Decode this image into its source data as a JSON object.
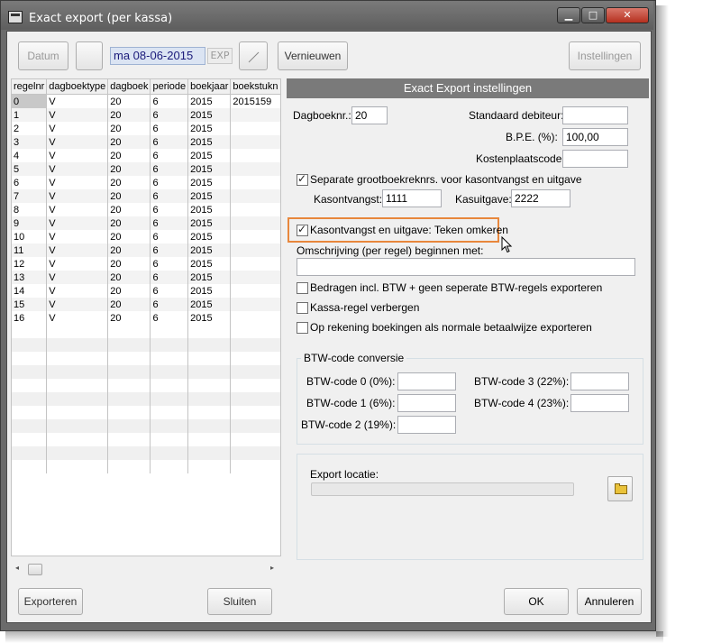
{
  "window": {
    "title": "Exact export (per kassa)",
    "minimize_glyph": "▁",
    "maximize_glyph": "□",
    "close_glyph": "✕"
  },
  "toolbar": {
    "datum_label": "Datum",
    "date_value": "ma 08-06-2015",
    "exp_label": "EXP",
    "refresh_label": "Vernieuwen",
    "settings_label": "Instellingen"
  },
  "table": {
    "columns": [
      "regelnr",
      "dagboektype",
      "dagboek",
      "periode",
      "boekjaar",
      "boekstukn"
    ],
    "rows": [
      [
        "0",
        "V",
        "20",
        "6",
        "2015",
        "2015159"
      ],
      [
        "1",
        "V",
        "20",
        "6",
        "2015",
        ""
      ],
      [
        "2",
        "V",
        "20",
        "6",
        "2015",
        ""
      ],
      [
        "3",
        "V",
        "20",
        "6",
        "2015",
        ""
      ],
      [
        "4",
        "V",
        "20",
        "6",
        "2015",
        ""
      ],
      [
        "5",
        "V",
        "20",
        "6",
        "2015",
        ""
      ],
      [
        "6",
        "V",
        "20",
        "6",
        "2015",
        ""
      ],
      [
        "7",
        "V",
        "20",
        "6",
        "2015",
        ""
      ],
      [
        "8",
        "V",
        "20",
        "6",
        "2015",
        ""
      ],
      [
        "9",
        "V",
        "20",
        "6",
        "2015",
        ""
      ],
      [
        "10",
        "V",
        "20",
        "6",
        "2015",
        ""
      ],
      [
        "11",
        "V",
        "20",
        "6",
        "2015",
        ""
      ],
      [
        "12",
        "V",
        "20",
        "6",
        "2015",
        ""
      ],
      [
        "13",
        "V",
        "20",
        "6",
        "2015",
        ""
      ],
      [
        "14",
        "V",
        "20",
        "6",
        "2015",
        ""
      ],
      [
        "15",
        "V",
        "20",
        "6",
        "2015",
        ""
      ],
      [
        "16",
        "V",
        "20",
        "6",
        "2015",
        ""
      ]
    ],
    "scroll_left": "◂",
    "scroll_right": "▸"
  },
  "settings": {
    "header": "Exact Export instellingen",
    "dagboeknr_label": "Dagboeknr.:",
    "dagboeknr_value": "20",
    "std_debiteur_label": "Standaard debiteur:",
    "std_debiteur_value": "",
    "bpe_label": "B.P.E. (%):",
    "bpe_value": "100,00",
    "kostenplaats_label": "Kostenplaatscode:",
    "kostenplaats_value": "",
    "separate_label": "Separate grootboekreknrs. voor kasontvangst en uitgave",
    "separate_checked": true,
    "kasontvangst_label": "Kasontvangst:",
    "kasontvangst_value": "1111",
    "kasuitgave_label": "Kasuitgave:",
    "kasuitgave_value": "2222",
    "omkeren_label": "Kasontvangst en uitgave: Teken omkeren",
    "omkeren_checked": true,
    "omschrijving_label": "Omschrijving (per regel) beginnen met:",
    "omschrijving_value": "",
    "incl_btw_label": "Bedragen incl. BTW + geen seperate BTW-regels exporteren",
    "incl_btw_checked": false,
    "kassa_regel_label": "Kassa-regel verbergen",
    "kassa_regel_checked": false,
    "op_rekening_label": "Op rekening boekingen als normale betaalwijze exporteren",
    "op_rekening_checked": false,
    "btw_group_title": "BTW-code conversie",
    "btw0_label": "BTW-code 0 (0%):",
    "btw1_label": "BTW-code 1 (6%):",
    "btw2_label": "BTW-code 2 (19%):",
    "btw3_label": "BTW-code 3 (22%):",
    "btw4_label": "BTW-code 4 (23%):",
    "export_locatie_label": "Export locatie:"
  },
  "footer": {
    "export_label": "Exporteren",
    "close_label": "Sluiten",
    "ok_label": "OK",
    "cancel_label": "Annuleren"
  },
  "colors": {
    "title_bar": "#6b6b6b",
    "panel_header": "#7a7a7a",
    "highlight": "#e8873c",
    "date_field": "#dbe4f3"
  }
}
